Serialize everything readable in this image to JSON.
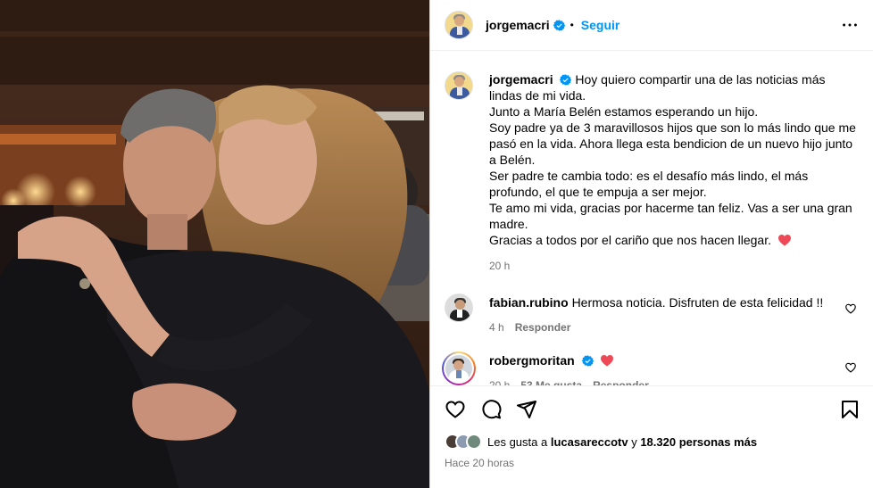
{
  "post": {
    "photo_alt": "",
    "header": {
      "username": "jorgemacri",
      "separator": "•",
      "follow_label": "Seguir"
    },
    "caption": {
      "username": "jorgemacri",
      "lines": [
        "Hoy quiero compartir una de las noticias más lindas de mi vida.",
        "Junto a María Belén estamos esperando un hijo.",
        "Soy padre ya de 3 maravillosos hijos que son lo más lindo que me pasó en la vida. Ahora llega esta bendicion de un nuevo hijo junto a Belén.",
        "Ser padre te cambia todo: es el desafío más lindo, el más profundo, el que te empuja a ser mejor.",
        "Te amo mi vida, gracias por hacerme tan feliz. Vas a ser una gran madre.",
        "Gracias a todos por el cariño que nos hacen llegar."
      ],
      "time": "20 h"
    },
    "comments": [
      {
        "username": "fabian.rubino",
        "text": "Hermosa noticia. Disfruten de esta felicidad !!",
        "time": "4 h",
        "reply_label": "Responder"
      },
      {
        "username": "robergmoritan",
        "text": "",
        "time": "20 h",
        "likes_label": "53 Me gusta",
        "reply_label": "Responder"
      }
    ],
    "likes": {
      "prefix": "Les gusta a",
      "first_user": "lucasareccotv",
      "joiner": "y",
      "others": "18.320 personas más"
    },
    "posted_ago": "Hace 20 horas"
  },
  "colors": {
    "accent_blue": "#0095f6",
    "heart_red": "#ed4956",
    "muted_text": "#737373"
  },
  "icons": [
    "verified-badge-icon",
    "more-options-icon",
    "heart-icon",
    "comment-icon",
    "share-icon",
    "bookmark-icon",
    "red-heart-emoji"
  ]
}
